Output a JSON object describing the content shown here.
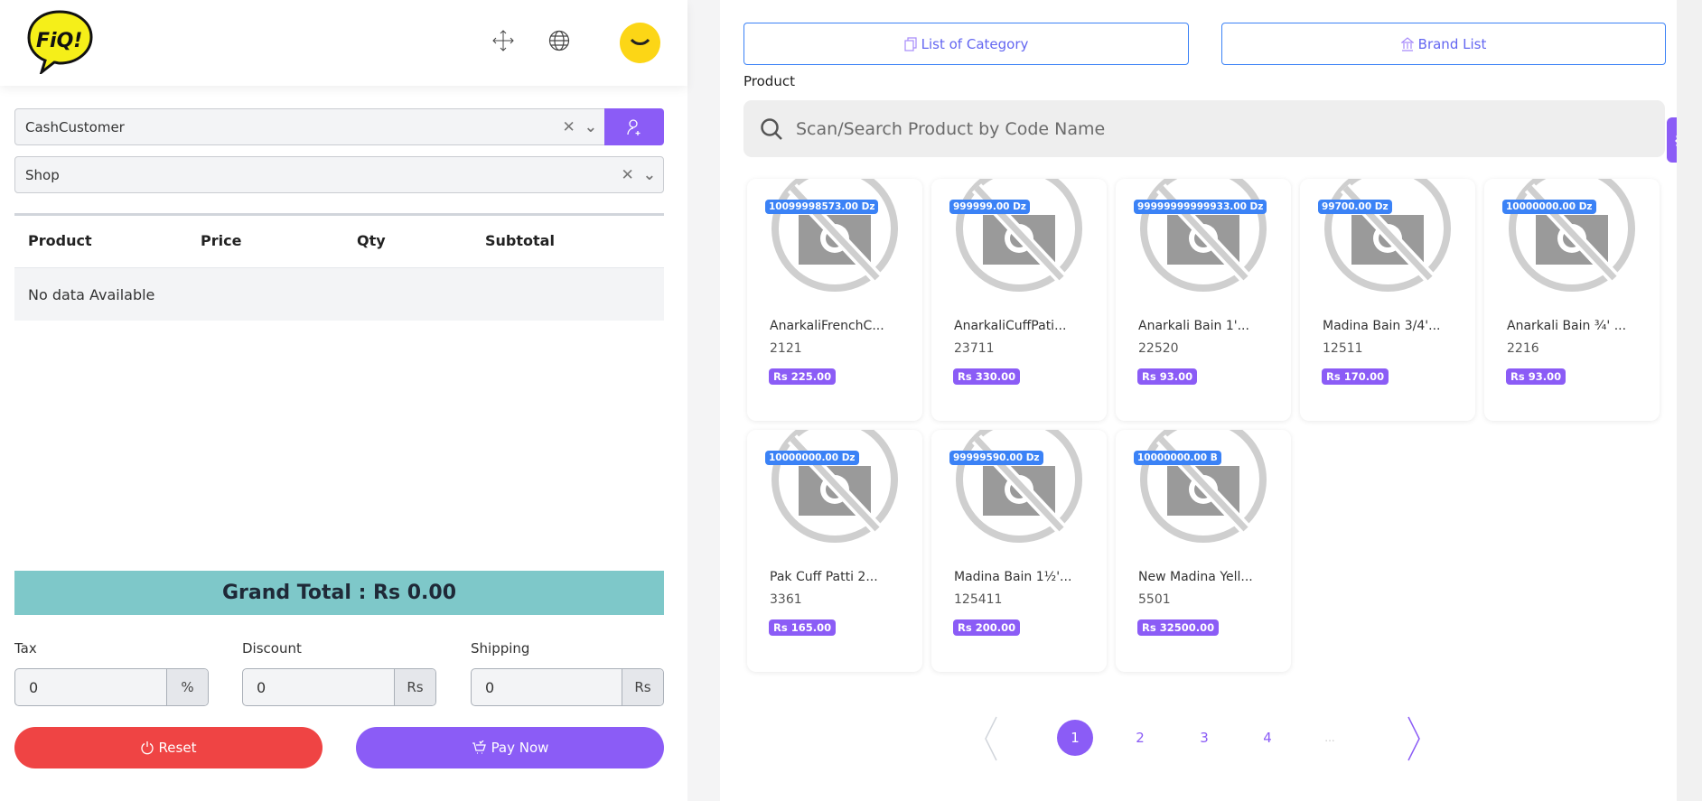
{
  "header": {
    "logo_text": "FiQ!"
  },
  "customer": {
    "value": "CashCustomer",
    "warehouse": "Shop"
  },
  "cart": {
    "columns": [
      "Product",
      "Price",
      "Qty",
      "Subtotal"
    ],
    "empty": "No data Available"
  },
  "grand_total": "Grand Total : Rs 0.00",
  "fields": [
    {
      "label": "Tax",
      "value": "0",
      "addon": "%"
    },
    {
      "label": "Discount",
      "value": "0",
      "addon": "Rs"
    },
    {
      "label": "Shipping",
      "value": "0",
      "addon": "Rs"
    }
  ],
  "buttons": {
    "reset": "Reset",
    "pay": "Pay Now",
    "category": "List of Category",
    "brand": "Brand List"
  },
  "search": {
    "label": "Product",
    "placeholder": "Scan/Search Product by Code Name"
  },
  "products": [
    {
      "qty": "10099998573.00 Dz",
      "name": "AnarkaliFrenchC...",
      "code": "2121",
      "price": "Rs 225.00"
    },
    {
      "qty": "999999.00 Dz",
      "name": "AnarkaliCuffPati...",
      "code": "23711",
      "price": "Rs 330.00"
    },
    {
      "qty": "99999999999933.00 Dz",
      "name": "Anarkali Bain 1'...",
      "code": "22520",
      "price": "Rs 93.00"
    },
    {
      "qty": "99700.00 Dz",
      "name": "Madina Bain 3/4'...",
      "code": "12511",
      "price": "Rs 170.00"
    },
    {
      "qty": "10000000.00 Dz",
      "name": "Anarkali Bain ¾' ...",
      "code": "2216",
      "price": "Rs 93.00"
    },
    {
      "qty": "10000000.00 Dz",
      "name": "Pak Cuff Patti 2...",
      "code": "3361",
      "price": "Rs 165.00"
    },
    {
      "qty": "99999590.00 Dz",
      "name": "Madina Bain 1½'...",
      "code": "125411",
      "price": "Rs 200.00"
    },
    {
      "qty": "10000000.00 B",
      "name": "New Madina Yell...",
      "code": "5501",
      "price": "Rs 32500.00"
    }
  ],
  "pagination": {
    "pages": [
      "1",
      "2",
      "3",
      "4"
    ],
    "ellipsis": "...",
    "current": "1"
  },
  "colors": {
    "accent": "#8b5cf6",
    "danger": "#ef4444",
    "total_bg": "#7ec8c9",
    "badge": "#3b82f6"
  }
}
